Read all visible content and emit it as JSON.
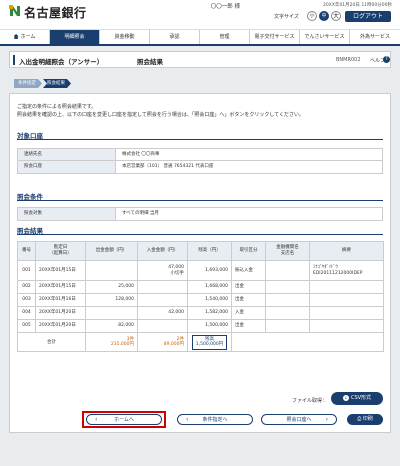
{
  "header": {
    "bank_name": "名古屋銀行",
    "user_line": "〇〇一郎 様",
    "last_login": "20XX年01月20日 11時00分00秒",
    "text_size_label": "文字サイズ",
    "size_small": "小",
    "size_mid": "中",
    "size_large": "大",
    "logout_label": "ログアウト"
  },
  "nav": {
    "items": [
      {
        "label": "ホーム"
      },
      {
        "label": "明細照会"
      },
      {
        "label": "資金移動"
      },
      {
        "label": "承認"
      },
      {
        "label": "管理"
      },
      {
        "label": "電子交付サービス"
      },
      {
        "label": "でんさいサービス"
      },
      {
        "label": "外為サービス"
      }
    ]
  },
  "page": {
    "title": "入出金明細照会（アンサー）",
    "subtitle": "照会結果",
    "screen_code": "BNMR002",
    "help_label": "ヘルプ",
    "help_icon": "?"
  },
  "steps": [
    "条件指定",
    "照会結果"
  ],
  "intro": {
    "line1": "ご指定の条件による照会結果です。",
    "line2": "照会結果を確認の上、以下の口座を変更し口座を指定して照会を行う場合は、「照会口座」へ」ボタンをクリックしてください。"
  },
  "account": {
    "title": "対象口座",
    "rows": [
      {
        "key": "連絡先名",
        "value": "株式会社 〇〇商事"
      },
      {
        "key": "照会口座",
        "value": "本店営業部（101） 普通 7654321 代表口座"
      }
    ]
  },
  "condition": {
    "title": "照会条件",
    "rows": [
      {
        "key": "照会対象",
        "value": "すべての明細 当月"
      }
    ]
  },
  "results": {
    "title": "照会結果",
    "headers": [
      "番号",
      "勘定日\n（起算日）",
      "出金金額（円）",
      "入金金額（円）",
      "残高（円）",
      "取引区分",
      "金融機関名\n支店名",
      "摘要"
    ],
    "rows": [
      {
        "no": "001",
        "date": "20XX年01月15日",
        "out": "",
        "in": "47,000\n小切手",
        "balance": "1,693,000",
        "type": "振込入金",
        "bank": "",
        "memo": "ﾐﾅｺﾞﾔﾀﾞｲﾄﾞｳ\nEDI20111212000IDEP"
      },
      {
        "no": "002",
        "date": "20XX年01月15日",
        "out": "25,000",
        "in": "",
        "balance": "1,668,000",
        "type": "出金",
        "bank": "",
        "memo": ""
      },
      {
        "no": "003",
        "date": "20XX年01月16日",
        "out": "128,000",
        "in": "",
        "balance": "1,540,000",
        "type": "出金",
        "bank": "",
        "memo": ""
      },
      {
        "no": "004",
        "date": "20XX年01月20日",
        "out": "",
        "in": "42,000",
        "balance": "1,582,000",
        "type": "入金",
        "bank": "",
        "memo": ""
      },
      {
        "no": "005",
        "date": "20XX年01月20日",
        "out": "82,000",
        "in": "",
        "balance": "1,500,000",
        "type": "出金",
        "bank": "",
        "memo": ""
      }
    ],
    "total": {
      "label": "合計",
      "out_count": "3件",
      "out_sum": "235,000円",
      "in_count": "2件",
      "in_sum": "89,000円",
      "balance_label": "残高",
      "balance_sum": "1,500,000円"
    }
  },
  "actions": {
    "file_label": "ファイル取得：",
    "csv_label": "CSV形式",
    "home_label": "ホームへ",
    "cond_label": "条件指定へ",
    "next_label": "照会口座へ",
    "print_label": "印刷"
  },
  "colors": {
    "brand": "#1a3e6e",
    "highlight": "#d20000"
  }
}
